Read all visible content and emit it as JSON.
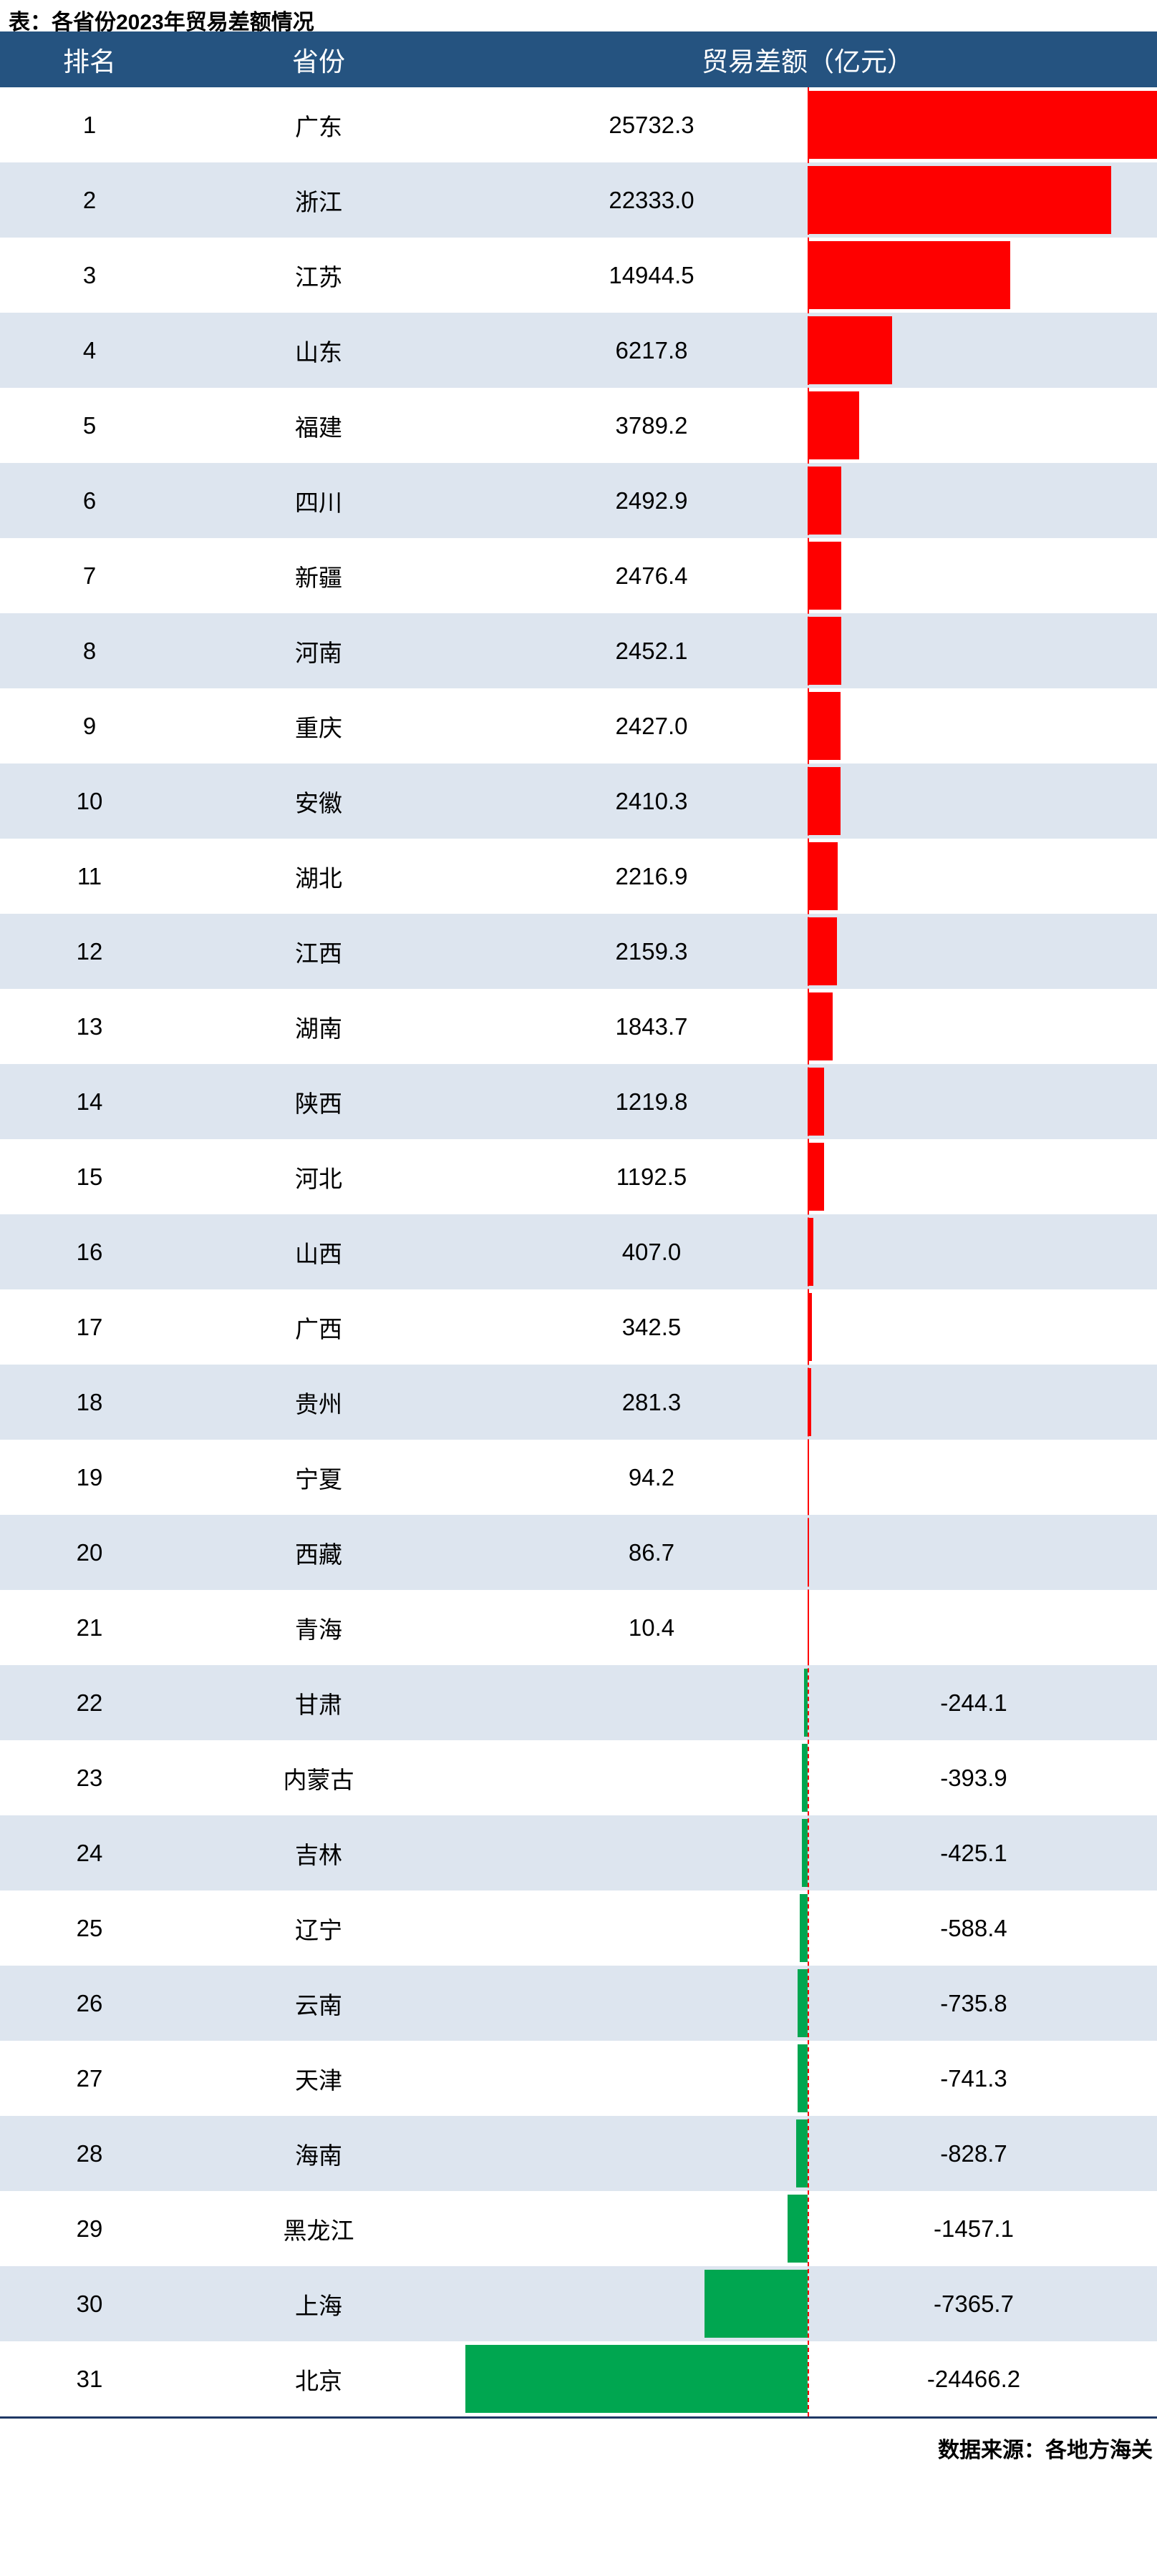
{
  "title": "表：各省份2023年贸易差额情况",
  "source_note": "数据来源：各地方海关",
  "colors": {
    "header_bg": "#255380",
    "row_alt_bg": "#dde5ef",
    "positive_bar": "#fe0000",
    "negative_bar": "#00a650",
    "footer_rule": "#1f3864",
    "header_text": "#ffffff",
    "body_text": "#000000"
  },
  "table": {
    "columns": [
      "排名",
      "省份",
      "贸易差额（亿元）"
    ],
    "rows": [
      {
        "rank": "1",
        "province": "广东",
        "value": "25732.3",
        "num": 25732.3
      },
      {
        "rank": "2",
        "province": "浙江",
        "value": "22333.0",
        "num": 22333.0
      },
      {
        "rank": "3",
        "province": "江苏",
        "value": "14944.5",
        "num": 14944.5
      },
      {
        "rank": "4",
        "province": "山东",
        "value": "6217.8",
        "num": 6217.8
      },
      {
        "rank": "5",
        "province": "福建",
        "value": "3789.2",
        "num": 3789.2
      },
      {
        "rank": "6",
        "province": "四川",
        "value": "2492.9",
        "num": 2492.9
      },
      {
        "rank": "7",
        "province": "新疆",
        "value": "2476.4",
        "num": 2476.4
      },
      {
        "rank": "8",
        "province": "河南",
        "value": "2452.1",
        "num": 2452.1
      },
      {
        "rank": "9",
        "province": "重庆",
        "value": "2427.0",
        "num": 2427.0
      },
      {
        "rank": "10",
        "province": "安徽",
        "value": "2410.3",
        "num": 2410.3
      },
      {
        "rank": "11",
        "province": "湖北",
        "value": "2216.9",
        "num": 2216.9
      },
      {
        "rank": "12",
        "province": "江西",
        "value": "2159.3",
        "num": 2159.3
      },
      {
        "rank": "13",
        "province": "湖南",
        "value": "1843.7",
        "num": 1843.7
      },
      {
        "rank": "14",
        "province": "陕西",
        "value": "1219.8",
        "num": 1219.8
      },
      {
        "rank": "15",
        "province": "河北",
        "value": "1192.5",
        "num": 1192.5
      },
      {
        "rank": "16",
        "province": "山西",
        "value": "407.0",
        "num": 407.0
      },
      {
        "rank": "17",
        "province": "广西",
        "value": "342.5",
        "num": 342.5
      },
      {
        "rank": "18",
        "province": "贵州",
        "value": "281.3",
        "num": 281.3
      },
      {
        "rank": "19",
        "province": "宁夏",
        "value": "94.2",
        "num": 94.2
      },
      {
        "rank": "20",
        "province": "西藏",
        "value": "86.7",
        "num": 86.7
      },
      {
        "rank": "21",
        "province": "青海",
        "value": "10.4",
        "num": 10.4
      },
      {
        "rank": "22",
        "province": "甘肃",
        "value": "-244.1",
        "num": -244.1
      },
      {
        "rank": "23",
        "province": "内蒙古",
        "value": "-393.9",
        "num": -393.9
      },
      {
        "rank": "24",
        "province": "吉林",
        "value": "-425.1",
        "num": -425.1
      },
      {
        "rank": "25",
        "province": "辽宁",
        "value": "-588.4",
        "num": -588.4
      },
      {
        "rank": "26",
        "province": "云南",
        "value": "-735.8",
        "num": -735.8
      },
      {
        "rank": "27",
        "province": "天津",
        "value": "-741.3",
        "num": -741.3
      },
      {
        "rank": "28",
        "province": "海南",
        "value": "-828.7",
        "num": -828.7
      },
      {
        "rank": "29",
        "province": "黑龙江",
        "value": "-1457.1",
        "num": -1457.1
      },
      {
        "rank": "30",
        "province": "上海",
        "value": "-7365.7",
        "num": -7365.7
      },
      {
        "rank": "31",
        "province": "北京",
        "value": "-24466.2",
        "num": -24466.2
      }
    ]
  },
  "chart_data": {
    "type": "bar",
    "title": "表：各省份2023年贸易差额情况",
    "xlabel": "贸易差额（亿元）",
    "ylabel": "省份",
    "orientation": "horizontal",
    "grid": false,
    "legend": null,
    "zero_line": 0,
    "xlim": [
      -24466.2,
      25732.3
    ],
    "categories": [
      "广东",
      "浙江",
      "江苏",
      "山东",
      "福建",
      "四川",
      "新疆",
      "河南",
      "重庆",
      "安徽",
      "湖北",
      "江西",
      "湖南",
      "陕西",
      "河北",
      "山西",
      "广西",
      "贵州",
      "宁夏",
      "西藏",
      "青海",
      "甘肃",
      "内蒙古",
      "吉林",
      "辽宁",
      "云南",
      "天津",
      "海南",
      "黑龙江",
      "上海",
      "北京"
    ],
    "values": [
      25732.3,
      22333.0,
      14944.5,
      6217.8,
      3789.2,
      2492.9,
      2476.4,
      2452.1,
      2427.0,
      2410.3,
      2216.9,
      2159.3,
      1843.7,
      1219.8,
      1192.5,
      407.0,
      342.5,
      281.3,
      94.2,
      86.7,
      10.4,
      -244.1,
      -393.9,
      -425.1,
      -588.4,
      -735.8,
      -741.3,
      -828.7,
      -1457.1,
      -7365.7,
      -24466.2
    ],
    "positive_color": "#fe0000",
    "negative_color": "#00a650",
    "annotation": "数据来源：各地方海关"
  }
}
